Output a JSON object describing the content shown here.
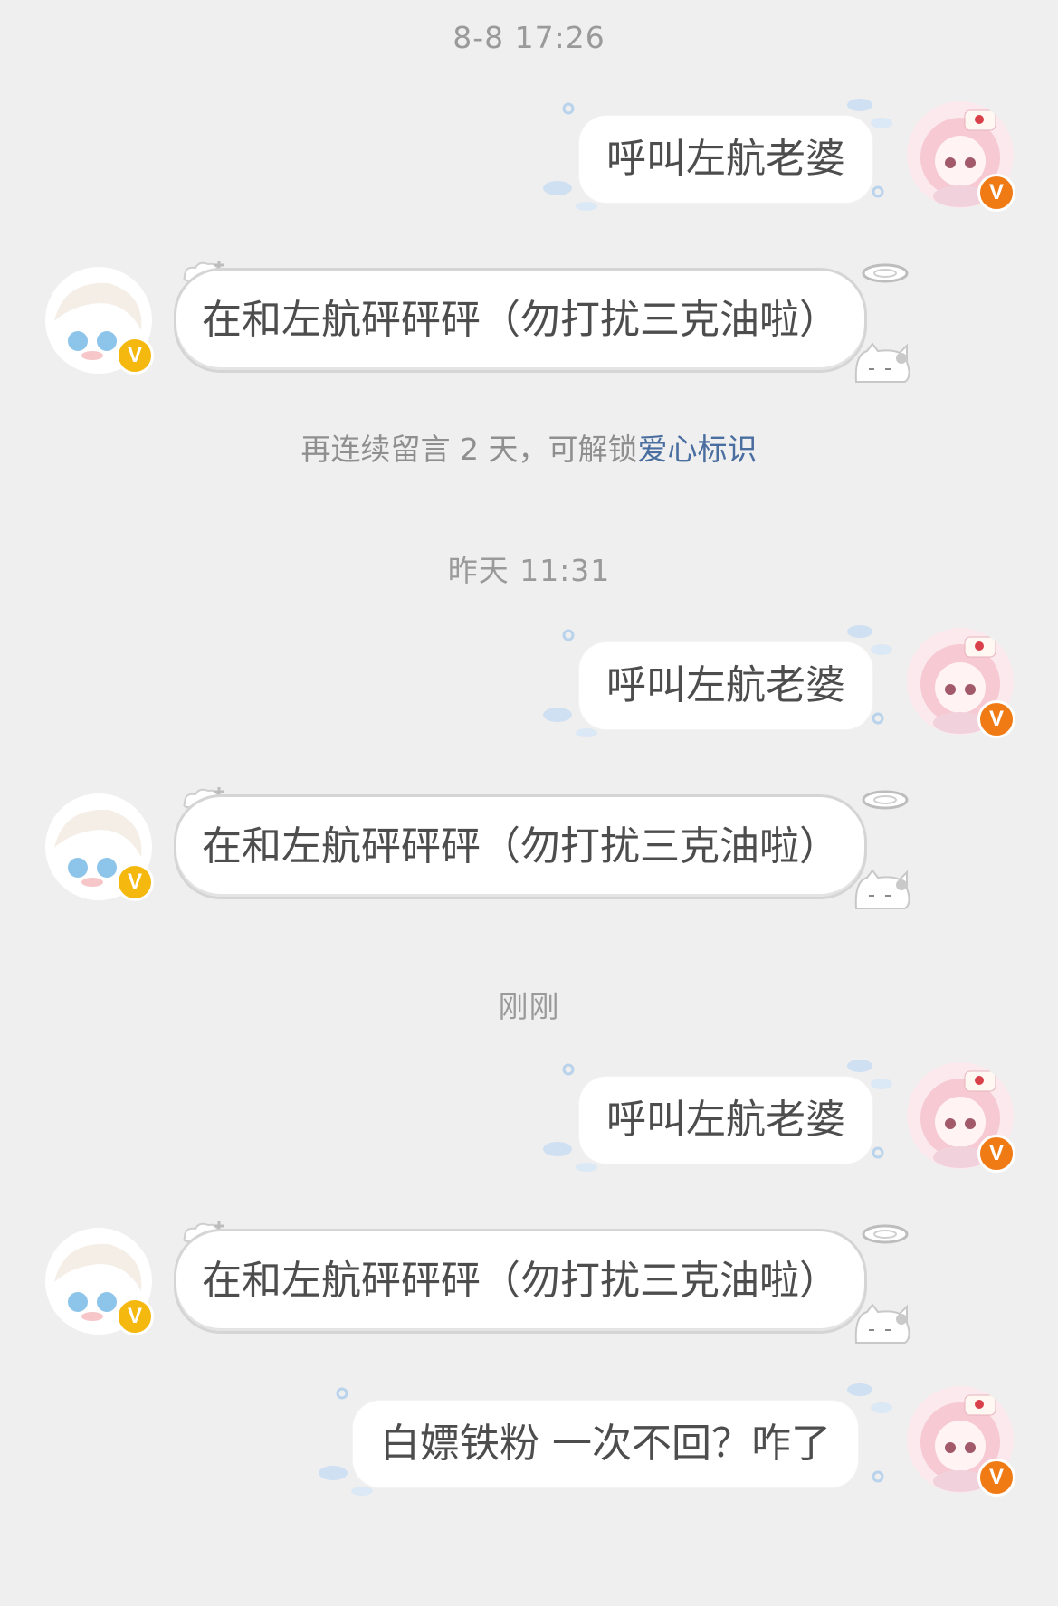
{
  "messages": [
    {
      "timestamp": "8-8 17:26",
      "outgoing": "呼叫左航老婆",
      "incoming": "在和左航砰砰砰（勿打扰三克油啦）"
    },
    {
      "timestamp": "昨天 11:31",
      "outgoing": "呼叫左航老婆",
      "incoming": "在和左航砰砰砰（勿打扰三克油啦）"
    },
    {
      "timestamp": "刚刚",
      "outgoing": "呼叫左航老婆",
      "incoming": "在和左航砰砰砰（勿打扰三克油啦）",
      "outgoing_last": "白嫖铁粉 一次不回？咋了"
    }
  ],
  "notice": {
    "prefix": "再连续留言 2 天，可解锁",
    "link": "爱心标识"
  },
  "badge": {
    "letter": "V",
    "self_color": "#f07a14",
    "other_color": "#f5b80f"
  },
  "icons": {
    "self_avatar": "pink-anime-girl-avatar",
    "other_avatar": "white-hair-anime-boy-avatar",
    "verified": "verified-v-icon"
  }
}
